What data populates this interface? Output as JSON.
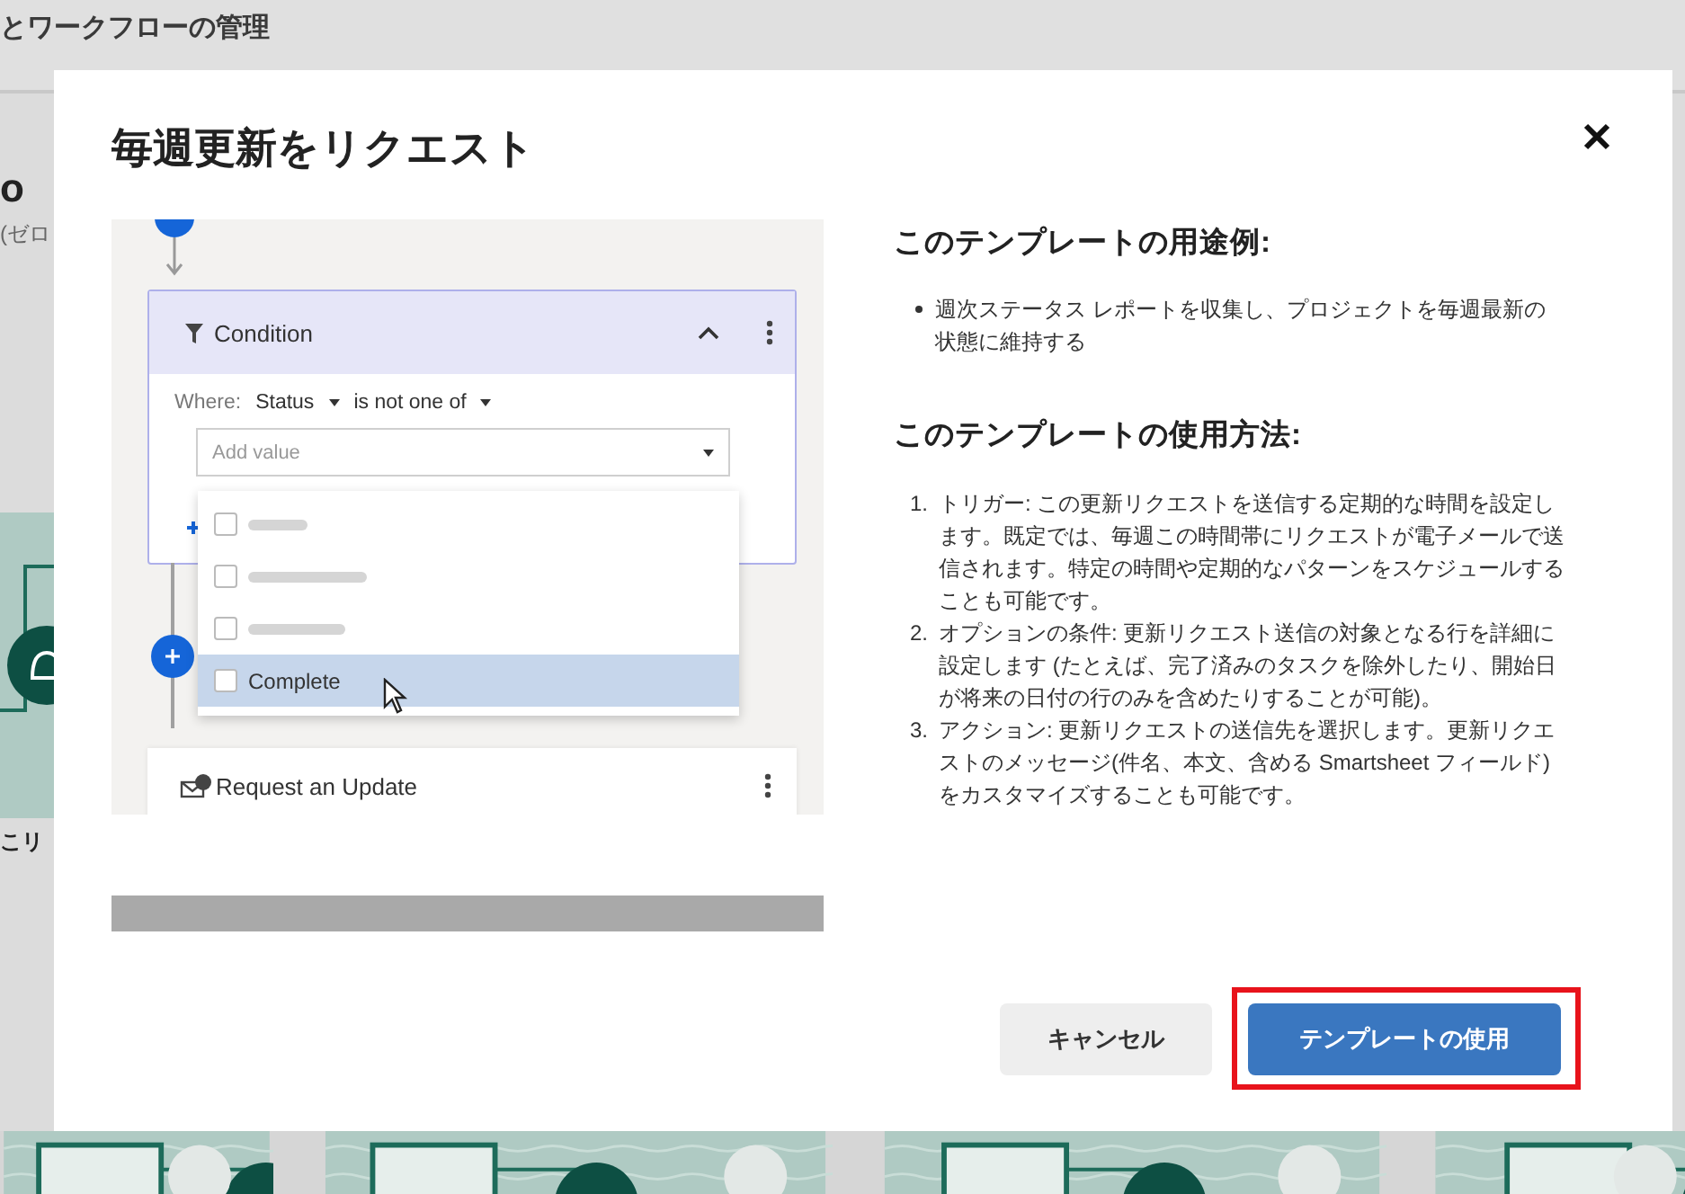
{
  "background": {
    "page_title": "とワークフローの管理",
    "heading_fragment": "o",
    "subtitle_fragment": "(ゼロ",
    "card_title_fragment": "こリ"
  },
  "dialog": {
    "title": "毎週更新をリクエスト",
    "preview": {
      "condition": {
        "title": "Condition",
        "where_label": "Where:",
        "field": "Status",
        "operator": "is not one of",
        "placeholder": "Add value",
        "options": [
          {
            "kind": "blank",
            "checked": false,
            "selected": false
          },
          {
            "kind": "blank",
            "checked": false,
            "selected": false
          },
          {
            "kind": "blank",
            "checked": false,
            "selected": false
          },
          {
            "kind": "text",
            "label": "Complete",
            "checked": false,
            "selected": true
          }
        ]
      },
      "action": {
        "title": "Request an Update"
      }
    },
    "sections": [
      {
        "kind": "bullets",
        "heading": "このテンプレートの用途例:",
        "items": [
          {
            "text": "週次ステータス レポートを収集し、プロジェクトを毎週最新の状態に維持する"
          }
        ]
      },
      {
        "kind": "numbered",
        "heading": "このテンプレートの使用方法:",
        "items": [
          {
            "number": "1.",
            "text": "トリガー: この更新リクエストを送信する定期的な時間を設定します。既定では、毎週この時間帯にリクエストが電子メールで送信されます。特定の時間や定期的なパターンをスケジュールすることも可能です。"
          },
          {
            "number": "2.",
            "text": "オプションの条件: 更新リクエスト送信の対象となる行を詳細に設定します (たとえば、完了済みのタスクを除外したり、開始日が将来の日付の行のみを含めたりすることが可能)。"
          },
          {
            "number": "3.",
            "text": "アクション: 更新リクエストの送信先を選択します。更新リクエストのメッセージ(件名、本文、含める Smartsheet フィールド) をカスタマイズすることも可能です。"
          }
        ]
      }
    ],
    "buttons": [
      {
        "kind": "secondary",
        "label": "キャンセル",
        "highlighted": false
      },
      {
        "kind": "primary",
        "label": "テンプレートの使用",
        "highlighted": true
      }
    ]
  }
}
